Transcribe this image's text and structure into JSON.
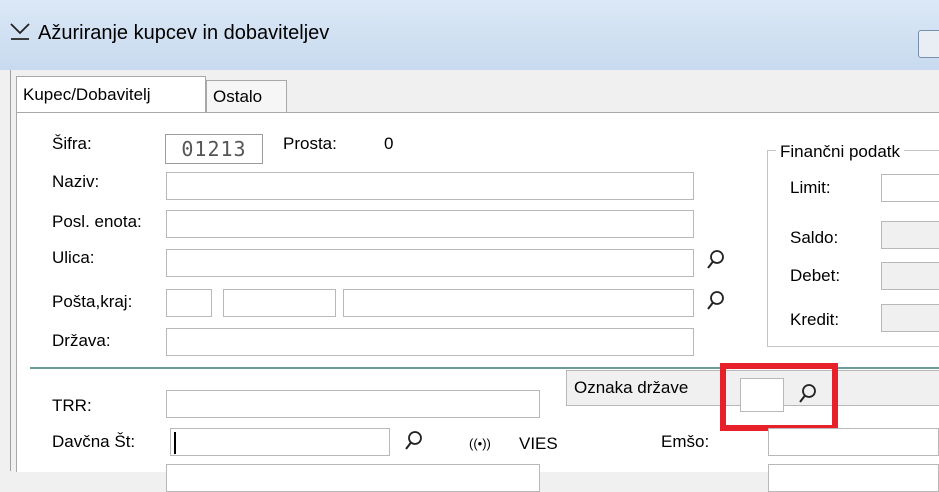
{
  "window": {
    "title": "Ažuriranje kupcev in dobaviteljev"
  },
  "tabs": [
    {
      "label": "Kupec/Dobavitelj"
    },
    {
      "label": "Ostalo"
    }
  ],
  "form": {
    "sifra_label": "Šifra:",
    "sifra_value": "01213",
    "prosta_label": "Prosta:",
    "prosta_value": "0",
    "naziv_label": "Naziv:",
    "posl_enota_label": "Posl. enota:",
    "ulica_label": "Ulica:",
    "posta_kraj_label": "Pošta,kraj:",
    "drzava_label": "Država:",
    "trr_label": "TRR:",
    "davcna_label": "Davčna Št:",
    "vies_label": "VIES",
    "vies_icon": "((•))",
    "emso_label": "Emšo:",
    "oznaka_drzave_label": "Oznaka države"
  },
  "financni": {
    "title": "Finančni podatk",
    "limit_label": "Limit:",
    "saldo_label": "Saldo:",
    "debet_label": "Debet:",
    "kredit_label": "Kredit:"
  },
  "colors": {
    "highlight": "#e8202a",
    "divider": "#6c9a98"
  }
}
